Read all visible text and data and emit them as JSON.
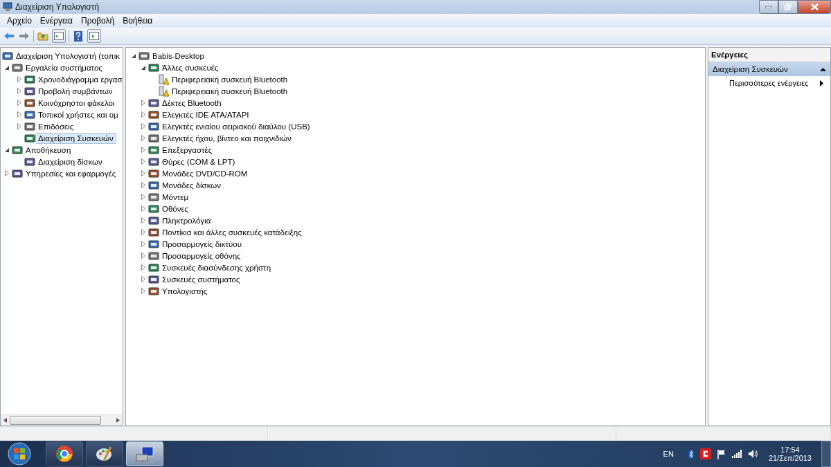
{
  "window": {
    "title": "Διαχείριση Υπολογιστή"
  },
  "menu": [
    "Αρχείο",
    "Ενέργεια",
    "Προβολή",
    "Βοήθεια"
  ],
  "navigation": {
    "root": {
      "label": "Διαχείριση Υπολογιστή (τοπικ",
      "children": [
        {
          "label": "Εργαλεία συστήματος",
          "expanded": true,
          "children": [
            {
              "label": "Χρονοδιάγραμμα εργασ",
              "expanded": false,
              "selected": false
            },
            {
              "label": "Προβολή συμβάντων",
              "expanded": false,
              "selected": false
            },
            {
              "label": "Κοινόχρηστοι φάκελοι",
              "expanded": false,
              "selected": false
            },
            {
              "label": "Τοπικοί χρήστες και ομ",
              "expanded": false,
              "selected": false
            },
            {
              "label": "Επιδόσεις",
              "expanded": false,
              "selected": false
            },
            {
              "label": "Διαχείριση Συσκευών",
              "selected": true
            }
          ]
        },
        {
          "label": "Αποθήκευση",
          "expanded": true,
          "children": [
            {
              "label": "Διαχείριση δίσκων",
              "selected": false
            }
          ]
        },
        {
          "label": "Υπηρεσίες και εφαρμογές",
          "expanded": false,
          "selected": false
        }
      ]
    }
  },
  "devices": {
    "label": "Babis-Desktop",
    "expanded": true,
    "children": [
      {
        "label": "Άλλες συσκευές",
        "expanded": true,
        "children": [
          {
            "label": "Περιφερειακή συσκευή Bluetooth",
            "warning": true
          },
          {
            "label": "Περιφερειακή συσκευή Bluetooth",
            "warning": true
          }
        ]
      },
      {
        "label": "Δέκτες Bluetooth",
        "expanded": false
      },
      {
        "label": "Ελεγκτές IDE ATA/ATAPI",
        "expanded": false
      },
      {
        "label": "Ελεγκτές ενιαίου σειριακού διαύλου (USB)",
        "expanded": false
      },
      {
        "label": "Ελεγκτές ήχου, βίντεο και παιχνιδιών",
        "expanded": false
      },
      {
        "label": "Επεξεργαστές",
        "expanded": false
      },
      {
        "label": "Θύρες (COM & LPT)",
        "expanded": false
      },
      {
        "label": "Μονάδες DVD/CD-ROM",
        "expanded": false
      },
      {
        "label": "Μονάδες δίσκων",
        "expanded": false
      },
      {
        "label": "Μόντεμ",
        "expanded": false
      },
      {
        "label": "Οθόνες",
        "expanded": false
      },
      {
        "label": "Πληκτρολόγια",
        "expanded": false
      },
      {
        "label": "Ποντίκια και άλλες συσκευές κατάδειξης",
        "expanded": false
      },
      {
        "label": "Προσαρμογείς δικτύου",
        "expanded": false
      },
      {
        "label": "Προσαρμογείς οθόνης",
        "expanded": false
      },
      {
        "label": "Συσκευές διασύνδεσης χρήστη",
        "expanded": false
      },
      {
        "label": "Συσκευές συστήματος",
        "expanded": false
      },
      {
        "label": "Υπολογιστής",
        "expanded": false
      }
    ]
  },
  "actions": {
    "title": "Ενέργειες",
    "section": {
      "label": "Διαχείριση Συσκευών",
      "expanded": true
    },
    "items": [
      "Περισσότερες ενέργειες"
    ]
  },
  "taskbar": {
    "apps": [
      {
        "selected": false
      },
      {
        "selected": false
      },
      {
        "selected": true
      }
    ],
    "language": "EN",
    "time": "17:54",
    "date": "21/Σεπ/2013"
  }
}
